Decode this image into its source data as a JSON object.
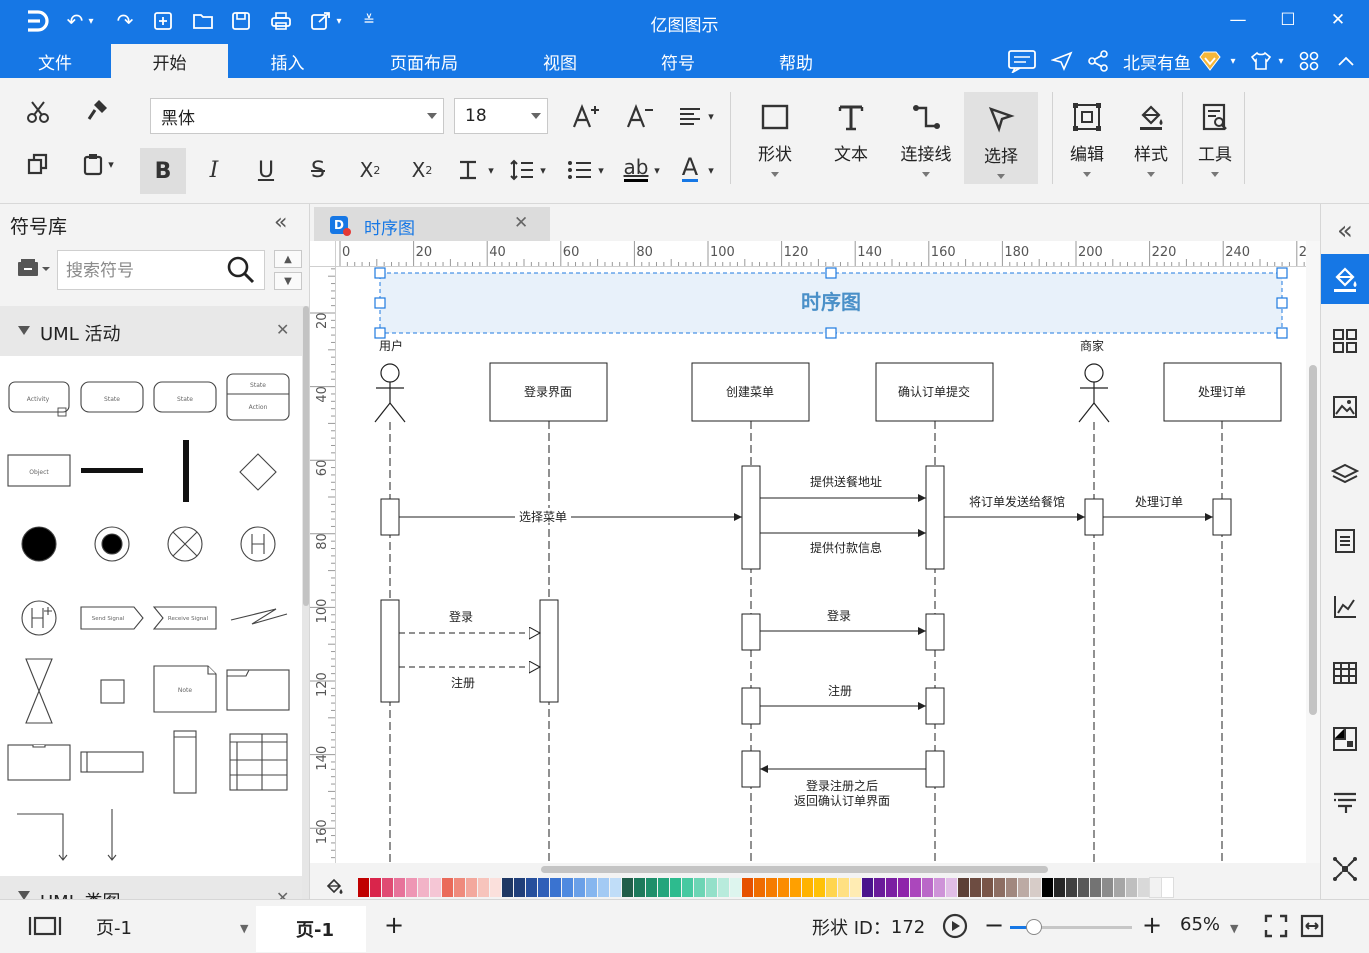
{
  "app": {
    "title": "亿图图示"
  },
  "menu": {
    "tabs": [
      {
        "label": "文件"
      },
      {
        "label": "开始"
      },
      {
        "label": "插入"
      },
      {
        "label": "页面布局"
      },
      {
        "label": "视图"
      },
      {
        "label": "符号"
      },
      {
        "label": "帮助"
      }
    ],
    "active_tab": "开始",
    "user_name": "北冥有鱼"
  },
  "ribbon": {
    "font_family": "黑体",
    "font_size": "18",
    "big_buttons": [
      {
        "label": "形状"
      },
      {
        "label": "文本"
      },
      {
        "label": "连接线"
      },
      {
        "label": "选择"
      },
      {
        "label": "编辑"
      },
      {
        "label": "样式"
      },
      {
        "label": "工具"
      }
    ]
  },
  "library": {
    "title": "符号库",
    "search_placeholder": "搜索符号",
    "categories": [
      {
        "label": "UML 活动"
      },
      {
        "label": "UML 类图"
      }
    ],
    "shape_labels": {
      "activity": "Activity",
      "state": "State",
      "action": "Action",
      "object": "Object",
      "send_signal": "Send Signal",
      "receive_signal": "Receive Signal",
      "note": "Note"
    }
  },
  "document": {
    "tab_label": "时序图"
  },
  "rulers": {
    "h_labels": [
      "0",
      "20",
      "40",
      "60",
      "80",
      "100",
      "120",
      "140",
      "160",
      "180",
      "200",
      "220",
      "240",
      "2"
    ],
    "v_labels": [
      "20",
      "40",
      "60",
      "80",
      "100",
      "120",
      "140",
      "160"
    ]
  },
  "diagram": {
    "title": "时序图",
    "actors": [
      {
        "label": "用户"
      },
      {
        "label": "商家"
      }
    ],
    "objects": [
      {
        "label": "登录界面"
      },
      {
        "label": "创建菜单"
      },
      {
        "label": "确认订单提交"
      },
      {
        "label": "处理订单"
      }
    ],
    "messages": {
      "select_menu": "选择菜单",
      "provide_address": "提供送餐地址",
      "provide_payment": "提供付款信息",
      "send_to_restaurant": "将订单发送给餐馆",
      "process_order": "处理订单",
      "login_left": "登录",
      "register_left": "注册",
      "login_right": "登录",
      "register_right": "注册",
      "after_register_1": "登录注册之后",
      "after_register_2": "返回确认订单界面"
    }
  },
  "palette": {
    "colors": [
      "#c00000",
      "#d9254b",
      "#e04b73",
      "#e7739a",
      "#ee96b4",
      "#f2b3c7",
      "#f5c6d5",
      "#ea6a5a",
      "#ef8a7c",
      "#f3a89d",
      "#f7c4bc",
      "#fbe0dc",
      "#1f3864",
      "#203f7a",
      "#264f9c",
      "#2f5fb8",
      "#3a73d0",
      "#4f8ae0",
      "#6aa0e8",
      "#86b6ef",
      "#a3caf4",
      "#c0ddf8",
      "#215e4a",
      "#1d7a5c",
      "#1f8f6b",
      "#24a57c",
      "#2dbb8e",
      "#47c9a1",
      "#6dd5b5",
      "#93e0c9",
      "#b8ebdc",
      "#ddf5ee",
      "#e65100",
      "#ef6c00",
      "#f57c00",
      "#fb8c00",
      "#ffa000",
      "#ffb300",
      "#ffc107",
      "#ffd54f",
      "#ffe082",
      "#ffecb3",
      "#4a148c",
      "#6a1b9a",
      "#7b1fa2",
      "#8e24aa",
      "#ab47bc",
      "#ba68c8",
      "#ce93d8",
      "#e1bee7",
      "#5d4037",
      "#6d4c41",
      "#795548",
      "#8d6e63",
      "#a1887f",
      "#bcaaa4",
      "#d7ccc8",
      "#000000",
      "#262626",
      "#404040",
      "#595959",
      "#737373",
      "#8c8c8c",
      "#a6a6a6",
      "#bfbfbf",
      "#d9d9d9",
      "#f2f2f2",
      "#ffffff"
    ]
  },
  "status": {
    "page_selector": "页-1",
    "page_tab": "页-1",
    "shape_id_label": "形状 ID：",
    "shape_id": "172",
    "zoom": "65%",
    "zoom_fraction": 0.2
  },
  "colors": {
    "accent": "#1677e5",
    "title_band": "#e8f1fa",
    "title_text": "#4a90c8"
  }
}
